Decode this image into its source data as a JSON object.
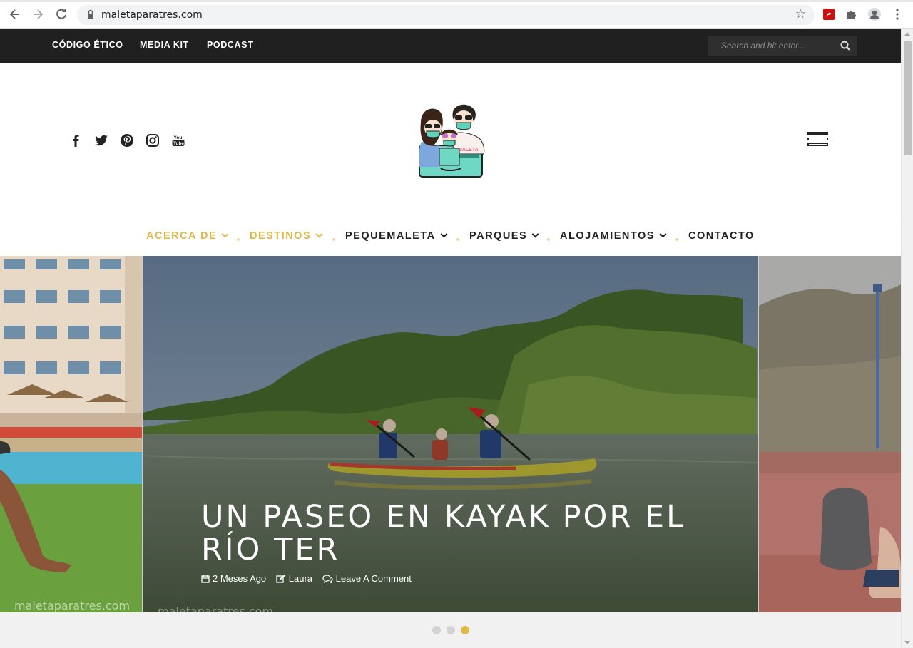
{
  "browser": {
    "url": "maletaparatres.com",
    "icons": [
      "back-icon",
      "forward-icon",
      "reload-icon",
      "lock-icon",
      "star-icon",
      "pdf-extension-icon",
      "puzzle-icon",
      "profile-icon",
      "more-icon"
    ]
  },
  "topbar": {
    "links": [
      {
        "label": "CÓDIGO ÉTICO"
      },
      {
        "label": "MEDIA KIT"
      },
      {
        "label": "PODCAST"
      }
    ],
    "search_placeholder": "Search and hit enter..."
  },
  "header": {
    "social": [
      "facebook-icon",
      "twitter-icon",
      "pinterest-icon",
      "instagram-icon",
      "youtube-icon"
    ],
    "logo_alt": "maletaparatres logo"
  },
  "nav": {
    "items": [
      {
        "label": "ACERCA DE",
        "dropdown": true,
        "color": "#e0b84a"
      },
      {
        "label": "DESTINOS",
        "dropdown": true,
        "color": "#e0b84a"
      },
      {
        "label": "PEQUEMALETA",
        "dropdown": true,
        "color": "#222222"
      },
      {
        "label": "PARQUES",
        "dropdown": true,
        "color": "#222222"
      },
      {
        "label": "ALOJAMIENTOS",
        "dropdown": true,
        "color": "#222222"
      },
      {
        "label": "CONTACTO",
        "dropdown": false,
        "color": "#222222"
      }
    ]
  },
  "slider": {
    "title": "UN PASEO EN KAYAK POR EL RÍO TER",
    "meta": {
      "date": "2 Meses Ago",
      "author": "Laura",
      "comments": "Leave A Comment"
    },
    "watermark_left": "maletaparatres.com",
    "watermark_main": "maletaparatres.com",
    "dots": 3,
    "active_dot": 3
  },
  "colors": {
    "accent": "#e0b84a",
    "topbar": "#202020",
    "text": "#222222"
  }
}
